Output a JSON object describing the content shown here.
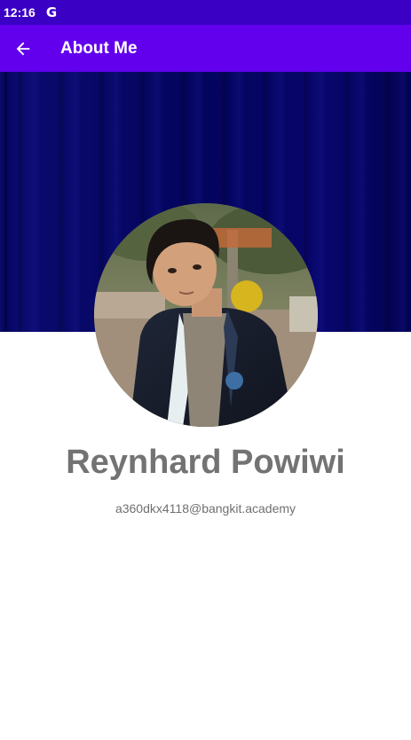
{
  "status_bar": {
    "time": "12:16",
    "notification_icon": "google-g-icon",
    "notification_glyph": "G"
  },
  "app_bar": {
    "title": "About Me",
    "back_icon": "arrow-back-icon",
    "background_color": "#6200ee"
  },
  "profile": {
    "name": "Reynhard Powiwi",
    "email": "a360dkx4118@bangkit.academy",
    "avatar": "profile-photo"
  },
  "colors": {
    "status_bar": "#3a00c4",
    "banner": "#03045c",
    "name_text": "#737373"
  }
}
